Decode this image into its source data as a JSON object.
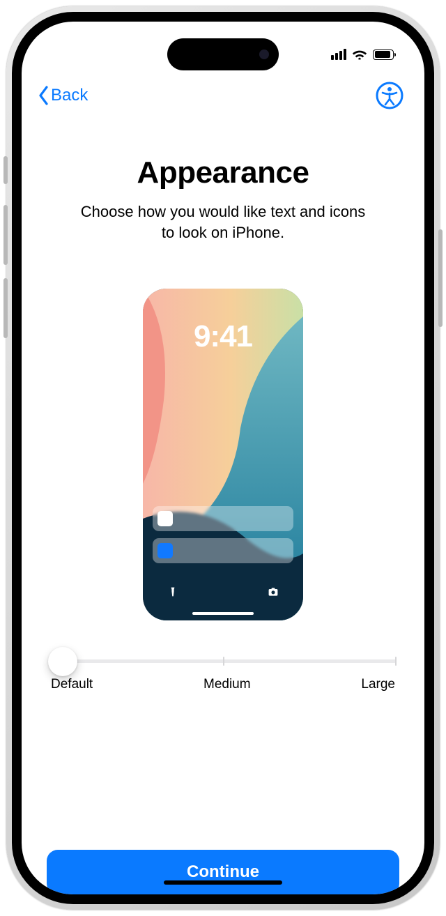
{
  "status": {
    "signal_level": 4,
    "wifi_level": 3,
    "battery_level": 90
  },
  "nav": {
    "back_label": "Back",
    "accessibility_icon": "accessibility-icon"
  },
  "header": {
    "title": "Appearance",
    "subtitle": "Choose how you would like text and icons to look on iPhone."
  },
  "preview": {
    "clock": "9:41",
    "flashlight_icon": "flashlight-icon",
    "camera_icon": "camera-icon"
  },
  "slider": {
    "value": "default",
    "options": [
      "Default",
      "Medium",
      "Large"
    ]
  },
  "actions": {
    "continue_label": "Continue"
  },
  "colors": {
    "accent": "#0a7aff"
  }
}
